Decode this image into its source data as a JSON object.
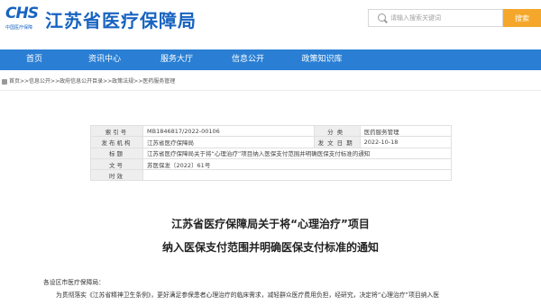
{
  "header": {
    "logo_text": "CHS",
    "logo_sub": "中国医疗保障",
    "site_title": "江苏省医疗保障局",
    "search_placeholder": "请输入搜索关键词",
    "search_button": "搜索"
  },
  "nav": {
    "items": [
      "首页",
      "资讯中心",
      "服务大厅",
      "信息公开",
      "政策知识库"
    ]
  },
  "breadcrumb": {
    "text": "首页>>信息公开>>政府信息公开目录>>政策法规>>医药服务管理"
  },
  "info": {
    "index_label": "索引号",
    "index_value": "MB1846817/2022-00106",
    "category_label": "分类",
    "category_value": "医药服务管理",
    "issuer_label": "发布机构",
    "issuer_value": "江苏省医疗保障局",
    "date_label": "发文日期",
    "date_value": "2022-10-18",
    "title_label": "标题",
    "title_value": "江苏省医疗保障局关于将“心理治疗”项目纳入医保支付范围并明确医保支付标准的通知",
    "docno_label": "文号",
    "docno_value": "苏医保发〔2022〕61号",
    "validity_label": "时效",
    "validity_value": ""
  },
  "doc": {
    "title_line1": "江苏省医疗保障局关于将“心理治疗”项目",
    "title_line2": "纳入医保支付范围并明确医保支付标准的通知",
    "salutation": "各设区市医疗保障局：",
    "para1": "为贯彻落实《江苏省精神卫生条例》，更好满足参保患者心理治疗的临床需求，减轻群众医疗费用负担，经研究，决定将“心理治疗”项目纳入医"
  }
}
